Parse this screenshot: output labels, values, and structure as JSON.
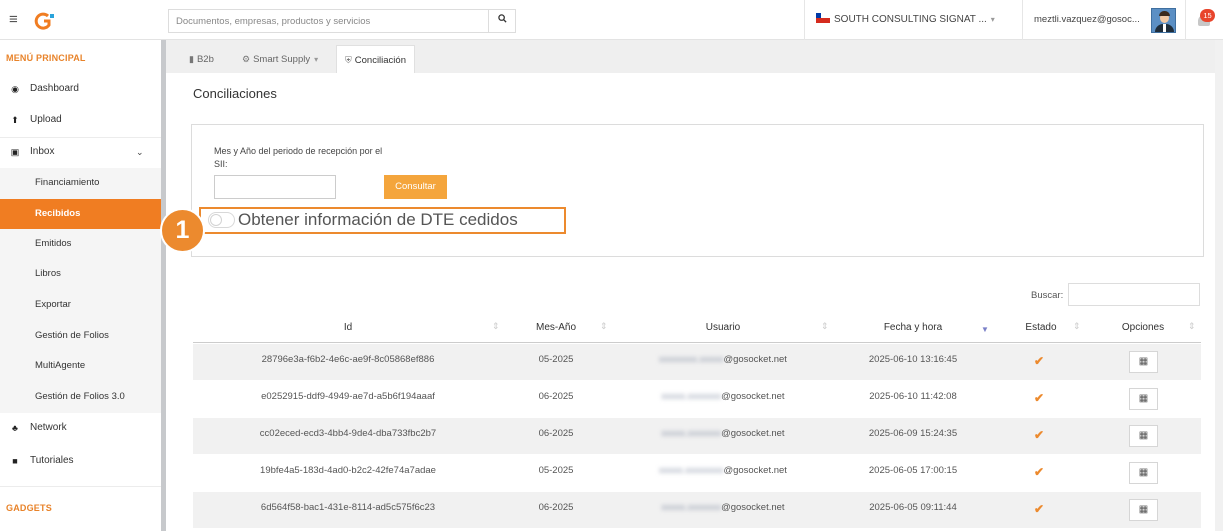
{
  "topbar": {
    "search_placeholder": "Documentos, empresas, productos y servicios",
    "company": "SOUTH CONSULTING SIGNAT ...",
    "user_email": "meztli.vazquez@gosoc...",
    "notification_count": "15",
    "icons": [
      "menu-icon",
      "logo-icon",
      "search-icon",
      "chile-flag-icon",
      "chevron-down-icon",
      "avatar",
      "bell-icon"
    ]
  },
  "sidebar": {
    "main_heading": "MENÚ PRINCIPAL",
    "items": [
      {
        "label": "Dashboard",
        "icon": "dashboard-icon"
      },
      {
        "label": "Upload",
        "icon": "upload-icon"
      },
      {
        "label": "Inbox",
        "icon": "inbox-icon"
      },
      {
        "label": "Network",
        "icon": "network-icon"
      },
      {
        "label": "Tutoriales",
        "icon": "video-icon"
      }
    ],
    "inbox_sub": [
      "Financiamiento",
      "Recibidos",
      "Emitidos",
      "Libros",
      "Exportar",
      "Gestión de Folios",
      "MultiAgente",
      "Gestión de Folios 3.0"
    ],
    "active_sub": "Recibidos",
    "gadgets_heading": "GADGETS"
  },
  "tabs": [
    {
      "label": "B2b",
      "icon": "file-icon"
    },
    {
      "label": "Smart Supply",
      "icon": "gear-icon"
    },
    {
      "label": "Conciliación",
      "icon": "shield-icon"
    }
  ],
  "active_tab": "Conciliación",
  "page": {
    "title": "Conciliaciones",
    "period_label": "Mes y Año del periodo de recepción por el SII:",
    "period_value": "",
    "consult_button": "Consultar",
    "dte_toggle_label": "Obtener información de DTE cedidos",
    "dte_toggle_on": false,
    "step_number": "1",
    "search_label": "Buscar:",
    "search_value": ""
  },
  "colors": {
    "accent": "#f07d22",
    "button": "#f4a53c",
    "highlight": "#ec8a2e",
    "sort_active": "#7a80c8"
  },
  "table": {
    "columns": [
      "Id",
      "Mes-Año",
      "Usuario",
      "Fecha y hora",
      "Estado",
      "Opciones"
    ],
    "sorted_column": "Fecha y hora",
    "rows": [
      {
        "id": "28796e3a-f6b2-4e6c-ae9f-8c05868ef886",
        "mes": "05-2025",
        "user_blur": "xxxxxxxx.xxxxx",
        "user_domain": "@gosocket.net",
        "fecha": "2025-06-10 13:16:45",
        "estado": "check"
      },
      {
        "id": "e0252915-ddf9-4949-ae7d-a5b6f194aaaf",
        "mes": "06-2025",
        "user_blur": "xxxxx.xxxxxxx",
        "user_domain": "@gosocket.net",
        "fecha": "2025-06-10 11:42:08",
        "estado": "check"
      },
      {
        "id": "cc02eced-ecd3-4bb4-9de4-dba733fbc2b7",
        "mes": "06-2025",
        "user_blur": "xxxxx.xxxxxxx",
        "user_domain": "@gosocket.net",
        "fecha": "2025-06-09 15:24:35",
        "estado": "check"
      },
      {
        "id": "19bfe4a5-183d-4ad0-b2c2-42fe74a7adae",
        "mes": "05-2025",
        "user_blur": "xxxxx.xxxxxxxx",
        "user_domain": "@gosocket.net",
        "fecha": "2025-06-05 17:00:15",
        "estado": "check"
      },
      {
        "id": "6d564f58-bac1-431e-8114-ad5c575f6c23",
        "mes": "06-2025",
        "user_blur": "xxxxx.xxxxxxx",
        "user_domain": "@gosocket.net",
        "fecha": "2025-06-05 09:11:44",
        "estado": "check"
      }
    ]
  }
}
